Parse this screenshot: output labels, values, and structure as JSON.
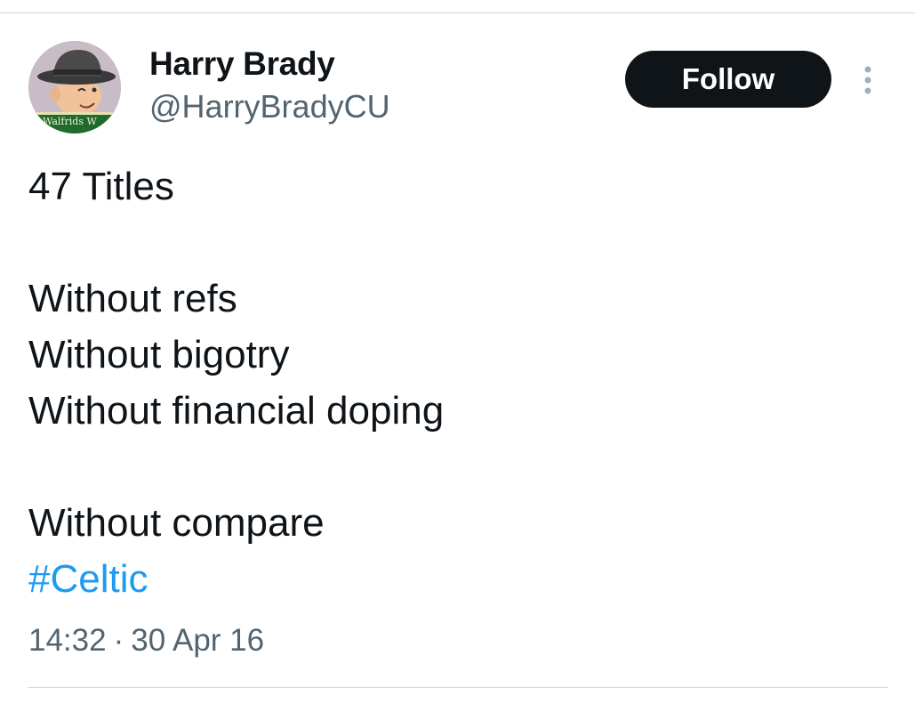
{
  "author": {
    "display_name": "Harry Brady",
    "handle": "@HarryBradyCU",
    "avatar_banner_text": "Walfrids W"
  },
  "actions": {
    "follow_label": "Follow",
    "more_icon": "more-vertical-icon"
  },
  "tweet": {
    "line1": "47 Titles",
    "line3": "Without refs",
    "line4": "Without bigotry",
    "line5": "Without financial doping",
    "line7": "Without compare",
    "hashtag": "#Celtic"
  },
  "meta": {
    "time": "14:32",
    "separator": "·",
    "date": "30 Apr 16"
  },
  "colors": {
    "text": "#0f1419",
    "secondary": "#536471",
    "link": "#1d9bf0",
    "button_bg": "#0f1419",
    "divider": "#cfd9de"
  }
}
